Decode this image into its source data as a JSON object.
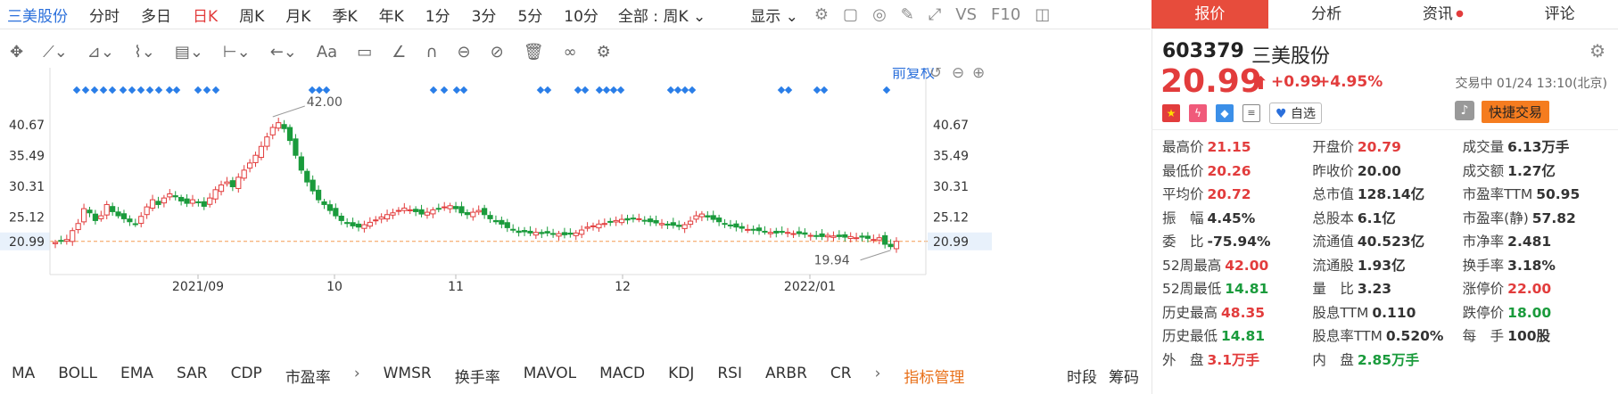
{
  "period_bar": {
    "stock_name": "三美股份",
    "periods": [
      "分时",
      "多日",
      "日K",
      "周K",
      "月K",
      "季K",
      "年K",
      "1分",
      "3分",
      "5分",
      "10分"
    ],
    "active_period": "日K",
    "range_select": "全部 : 周K",
    "display_label": "显示",
    "vs_label": "VS",
    "f10_label": "F10"
  },
  "chart": {
    "adjust_label": "前复权",
    "price_ticks": [
      "40.67",
      "35.49",
      "30.31",
      "25.12",
      "20.99"
    ],
    "current_price_tag": "20.99",
    "x_labels": [
      "2021/09",
      "10",
      "11",
      "12",
      "2022/01"
    ],
    "high_annotation": "42.00",
    "low_annotation": "19.94"
  },
  "indicator_bar": {
    "items": [
      "MA",
      "BOLL",
      "EMA",
      "SAR",
      "CDP",
      "市盈率",
      "WMSR",
      "换手率",
      "MAVOL",
      "MACD",
      "KDJ",
      "RSI",
      "ARBR",
      "CR"
    ],
    "manage_label": "指标管理",
    "right_items": [
      "时段",
      "筹码"
    ]
  },
  "right_tabs": [
    "报价",
    "分析",
    "资讯",
    "评论"
  ],
  "quote": {
    "code": "603379",
    "name": "三美股份",
    "price": "20.99",
    "change": "+0.99",
    "change_pct": "+4.95%",
    "status": "交易中 01/24 13:10(北京)",
    "watch_label": "自选",
    "trade_label": "快捷交易",
    "rows": [
      [
        {
          "l": "最高价",
          "v": "21.15",
          "c": "red"
        },
        {
          "l": "开盘价",
          "v": "20.79",
          "c": "red"
        },
        {
          "l": "成交量",
          "v": "6.13万手",
          "c": "dark"
        }
      ],
      [
        {
          "l": "最低价",
          "v": "20.26",
          "c": "red"
        },
        {
          "l": "昨收价",
          "v": "20.00",
          "c": "dark"
        },
        {
          "l": "成交额",
          "v": "1.27亿",
          "c": "dark"
        }
      ],
      [
        {
          "l": "平均价",
          "v": "20.72",
          "c": "red"
        },
        {
          "l": "总市值",
          "v": "128.14亿",
          "c": "dark"
        },
        {
          "l": "市盈率TTM",
          "v": "50.95",
          "c": "dark"
        }
      ],
      [
        {
          "l": "振　幅",
          "v": "4.45%",
          "c": "dark"
        },
        {
          "l": "总股本",
          "v": "6.1亿",
          "c": "dark"
        },
        {
          "l": "市盈率(静)",
          "v": "57.82",
          "c": "dark"
        }
      ],
      [
        {
          "l": "委　比",
          "v": "-75.94%",
          "c": "dark"
        },
        {
          "l": "流通值",
          "v": "40.523亿",
          "c": "dark"
        },
        {
          "l": "市净率",
          "v": "2.481",
          "c": "dark"
        }
      ],
      [
        {
          "l": "52周最高",
          "v": "42.00",
          "c": "red"
        },
        {
          "l": "流通股",
          "v": "1.93亿",
          "c": "dark"
        },
        {
          "l": "换手率",
          "v": "3.18%",
          "c": "dark"
        }
      ],
      [
        {
          "l": "52周最低",
          "v": "14.81",
          "c": "green"
        },
        {
          "l": "量　比",
          "v": "3.23",
          "c": "dark"
        },
        {
          "l": "涨停价",
          "v": "22.00",
          "c": "red"
        }
      ],
      [
        {
          "l": "历史最高",
          "v": "48.35",
          "c": "red"
        },
        {
          "l": "股息TTM",
          "v": "0.110",
          "c": "dark"
        },
        {
          "l": "跌停价",
          "v": "18.00",
          "c": "green"
        }
      ],
      [
        {
          "l": "历史最低",
          "v": "14.81",
          "c": "green"
        },
        {
          "l": "股息率TTM",
          "v": "0.520%",
          "c": "dark"
        },
        {
          "l": "每　手",
          "v": "100股",
          "c": "dark"
        }
      ],
      [
        {
          "l": "外　盘",
          "v": "3.1万手",
          "c": "red"
        },
        {
          "l": "内　盘",
          "v": "2.85万手",
          "c": "green"
        },
        {
          "l": "",
          "v": "",
          "c": "dark"
        }
      ]
    ]
  },
  "colors": {
    "up": "#e23c3c",
    "down": "#1a9b3c",
    "accent": "#e74c3c",
    "link": "#2a6fdb"
  }
}
